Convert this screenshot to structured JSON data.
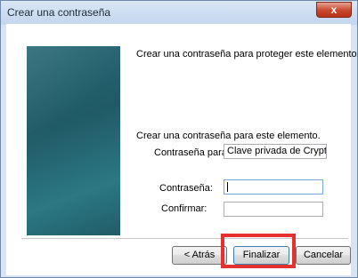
{
  "window": {
    "title": "Crear una contraseña",
    "close_glyph": "x"
  },
  "content": {
    "heading": "Crear una contraseña para proteger este elemento.",
    "subheading": "Crear una contraseña para este elemento.",
    "password_for_label": "Contraseña para:",
    "password_for_value": "Clave privada de CryptoA",
    "password_label": "Contraseña:",
    "password_value": "",
    "confirm_label": "Confirmar:",
    "confirm_value": ""
  },
  "buttons": {
    "back_label": "< Atrás",
    "finish_label": "Finalizar",
    "cancel_label": "Cancelar"
  },
  "colors": {
    "highlight": "#e53030",
    "side_panel": "#1f5a66"
  }
}
